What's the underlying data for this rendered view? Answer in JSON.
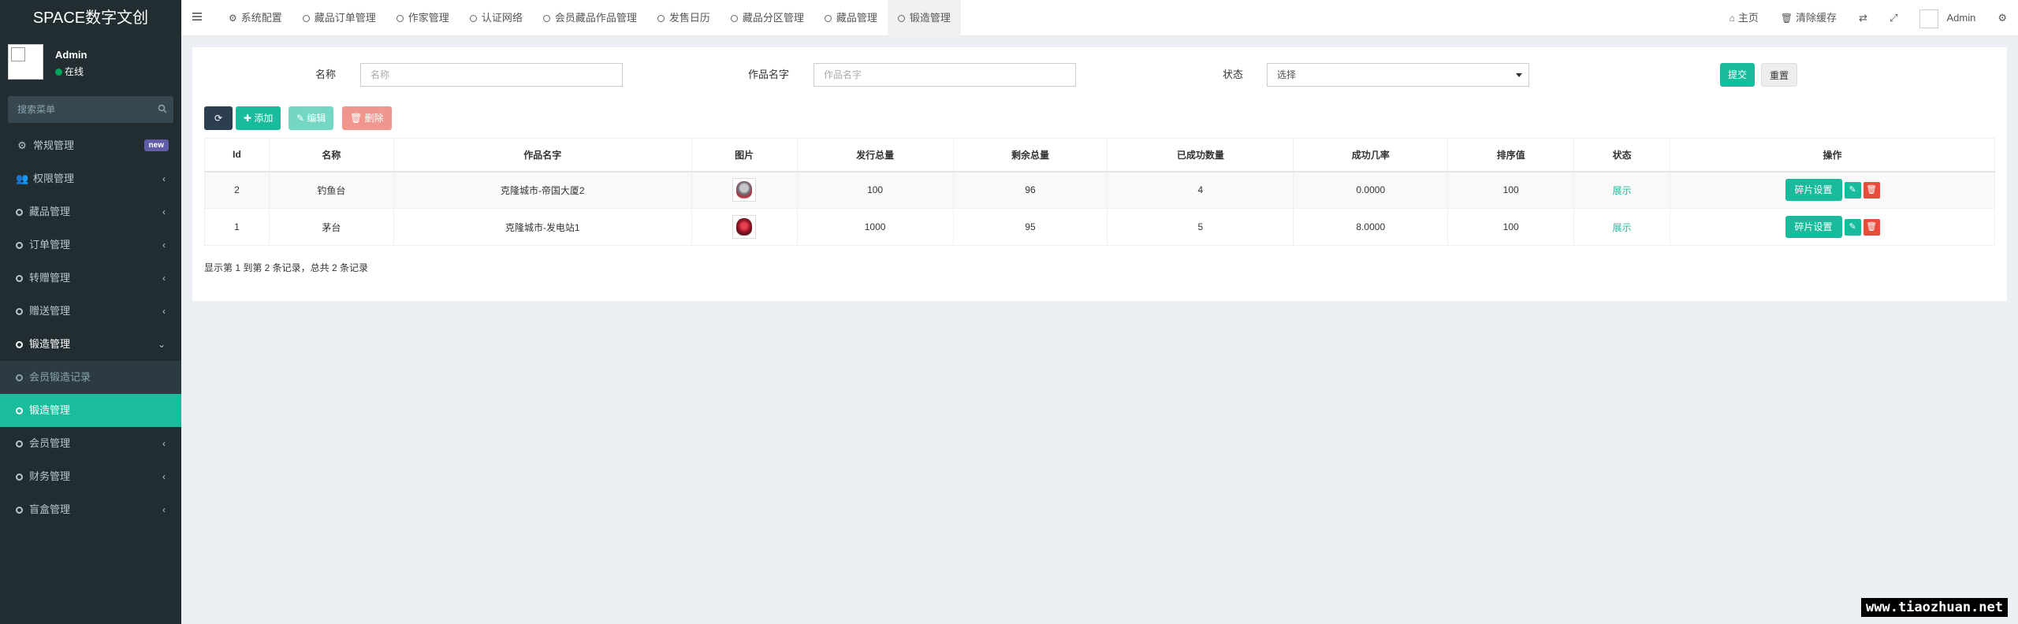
{
  "app": {
    "brand": "SPACE数字文创"
  },
  "user": {
    "name": "Admin",
    "status": "在线"
  },
  "sidebar": {
    "search_placeholder": "搜索菜单",
    "items": [
      {
        "label": "常规管理",
        "badge": "new"
      },
      {
        "label": "权限管理"
      },
      {
        "label": "藏品管理"
      },
      {
        "label": "订单管理"
      },
      {
        "label": "转赠管理"
      },
      {
        "label": "赠送管理"
      },
      {
        "label": "锻造管理"
      },
      {
        "label": "会员锻造记录"
      },
      {
        "label": "锻造管理"
      },
      {
        "label": "会员管理"
      },
      {
        "label": "财务管理"
      },
      {
        "label": "盲盒管理"
      }
    ]
  },
  "topbar": {
    "tabs": [
      {
        "label": "系统配置"
      },
      {
        "label": "藏品订单管理"
      },
      {
        "label": "作家管理"
      },
      {
        "label": "认证网络"
      },
      {
        "label": "会员藏品作品管理"
      },
      {
        "label": "发售日历"
      },
      {
        "label": "藏品分区管理"
      },
      {
        "label": "藏品管理"
      },
      {
        "label": "锻造管理"
      }
    ],
    "home": "主页",
    "clear_cache": "清除缓存",
    "user": "Admin"
  },
  "filters": {
    "name_label": "名称",
    "name_placeholder": "名称",
    "work_label": "作品名字",
    "work_placeholder": "作品名字",
    "status_label": "状态",
    "status_value": "选择",
    "submit": "提交",
    "reset": "重置"
  },
  "toolbar": {
    "add": "添加",
    "edit": "编辑",
    "delete": "删除"
  },
  "table": {
    "columns": [
      "Id",
      "名称",
      "作品名字",
      "图片",
      "发行总量",
      "剩余总量",
      "已成功数量",
      "成功几率",
      "排序值",
      "状态",
      "操作"
    ],
    "rows": [
      {
        "id": "2",
        "name": "钓鱼台",
        "work": "克隆城市-帝国大厦2",
        "image_icon": "thumb-gray",
        "total": "100",
        "remaining": "96",
        "success": "4",
        "rate": "0.0000",
        "sort": "100",
        "status": "展示",
        "op": "碎片设置"
      },
      {
        "id": "1",
        "name": "茅台",
        "work": "克隆城市-发电站1",
        "image_icon": "thumb-red",
        "total": "1000",
        "remaining": "95",
        "success": "5",
        "rate": "8.0000",
        "sort": "100",
        "status": "展示",
        "op": "碎片设置"
      }
    ]
  },
  "pager": "显示第 1 到第 2 条记录，总共 2 条记录",
  "watermark": "www.tiaozhuan.net",
  "colors": {
    "accent": "#18bc9c",
    "sidebar_bg": "#222d32",
    "danger": "#e74c3c",
    "dark": "#2c3e50"
  }
}
